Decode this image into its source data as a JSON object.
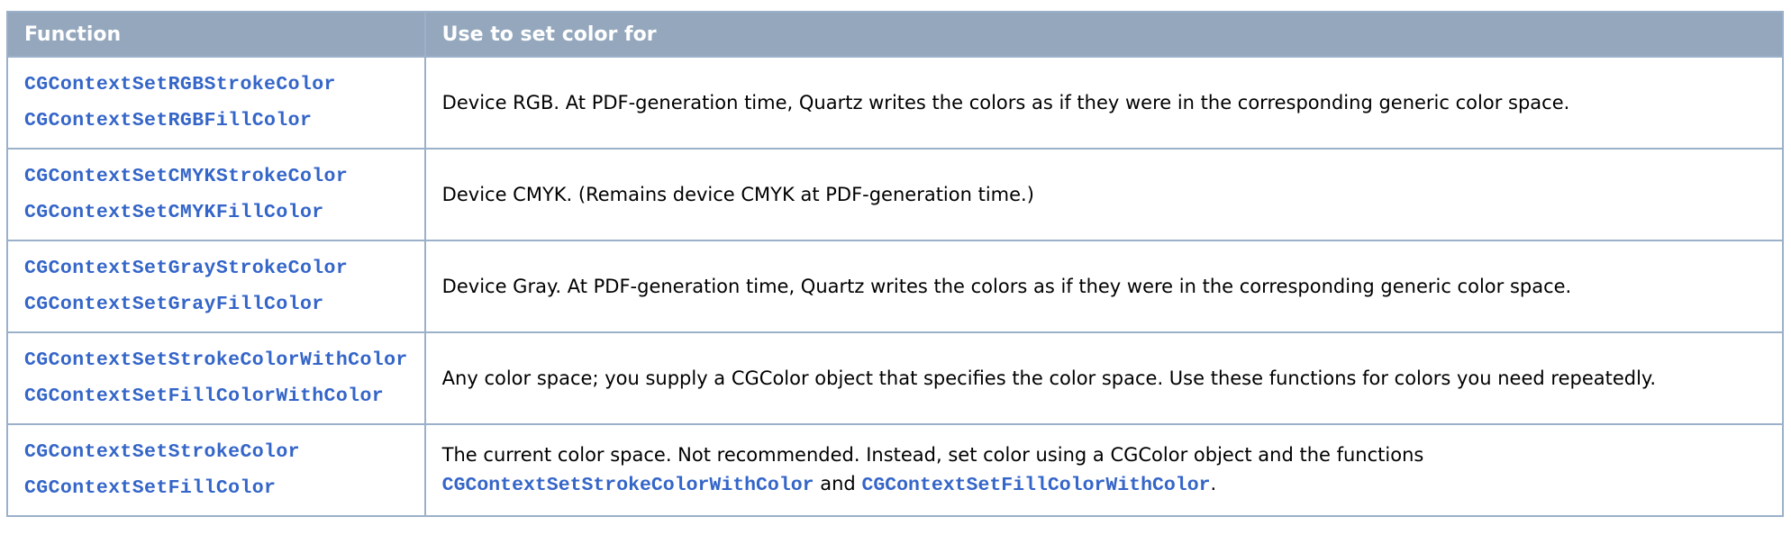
{
  "table": {
    "headers": [
      "Function",
      "Use to set color for"
    ],
    "rows": [
      {
        "functions": [
          "CGContextSetRGBStrokeColor",
          "CGContextSetRGBFillColor"
        ],
        "description": "Device RGB. At PDF-generation time, Quartz writes the colors as if they were in the corresponding generic color space."
      },
      {
        "functions": [
          "CGContextSetCMYKStrokeColor",
          "CGContextSetCMYKFillColor"
        ],
        "description": "Device CMYK. (Remains device CMYK at PDF-generation time.)"
      },
      {
        "functions": [
          "CGContextSetGrayStrokeColor",
          "CGContextSetGrayFillColor"
        ],
        "description": "Device Gray. At PDF-generation time, Quartz writes the colors as if they were in the corresponding generic color space."
      },
      {
        "functions": [
          "CGContextSetStrokeColorWithColor",
          "CGContextSetFillColorWithColor"
        ],
        "description": "Any color space; you supply a CGColor object that specifies the color space. Use these functions for colors you need repeatedly."
      },
      {
        "functions": [
          "CGContextSetStrokeColor",
          "CGContextSetFillColor"
        ],
        "description": "The current color space. Not recommended. Instead, set color using a CGColor object and the functions",
        "link1": "CGContextSetStrokeColorWithColor",
        "connector": "and",
        "link2": "CGContextSetFillColorWithColor",
        "end": "."
      }
    ]
  },
  "colors": {
    "header_bg": "#94a7bd",
    "border": "#9bb0c9",
    "link": "#3465c8"
  }
}
